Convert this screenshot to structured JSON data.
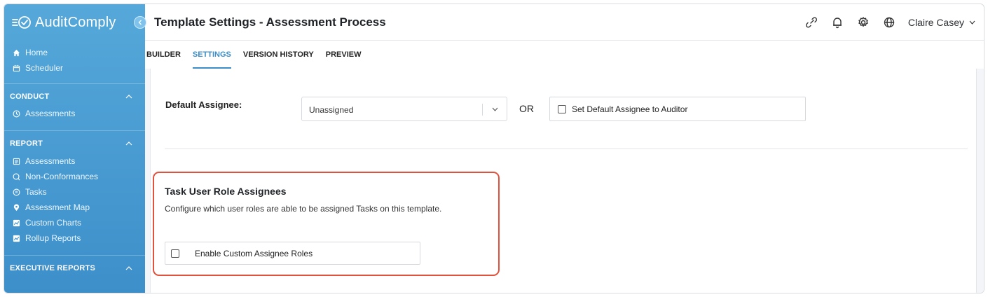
{
  "app": {
    "brand": "AuditComply"
  },
  "sidebar": {
    "top_items": [
      {
        "label": "Home",
        "icon": "home-icon"
      },
      {
        "label": "Scheduler",
        "icon": "calendar-icon"
      }
    ],
    "sections": [
      {
        "title": "CONDUCT",
        "items": [
          {
            "label": "Assessments",
            "icon": "clock-icon"
          }
        ]
      },
      {
        "title": "REPORT",
        "items": [
          {
            "label": "Assessments",
            "icon": "document-icon"
          },
          {
            "label": "Non-Conformances",
            "icon": "search-alert-icon"
          },
          {
            "label": "Tasks",
            "icon": "list-circle-icon"
          },
          {
            "label": "Assessment Map",
            "icon": "map-pin-icon"
          },
          {
            "label": "Custom Charts",
            "icon": "chart-icon"
          },
          {
            "label": "Rollup Reports",
            "icon": "chart-icon"
          }
        ]
      },
      {
        "title": "EXECUTIVE REPORTS",
        "items": []
      }
    ]
  },
  "header": {
    "title": "Template Settings - Assessment Process",
    "user_name": "Claire Casey"
  },
  "tabs": [
    {
      "label": "BUILDER",
      "active": false
    },
    {
      "label": "SETTINGS",
      "active": true
    },
    {
      "label": "VERSION HISTORY",
      "active": false
    },
    {
      "label": "PREVIEW",
      "active": false
    }
  ],
  "settings": {
    "default_assignee_label": "Default Assignee:",
    "default_assignee_value": "Unassigned",
    "or_label": "OR",
    "auditor_checkbox_label": "Set Default Assignee to Auditor",
    "auditor_checked": false,
    "task_roles": {
      "title": "Task User Role Assignees",
      "description": "Configure which user roles are able to be assigned Tasks on this template.",
      "enable_label": "Enable Custom Assignee Roles",
      "enable_checked": false
    }
  },
  "colors": {
    "sidebar_top": "#55a8d9",
    "sidebar_bottom": "#3d8fca",
    "accent": "#3b8ec9",
    "highlight_border": "#e0523e"
  }
}
